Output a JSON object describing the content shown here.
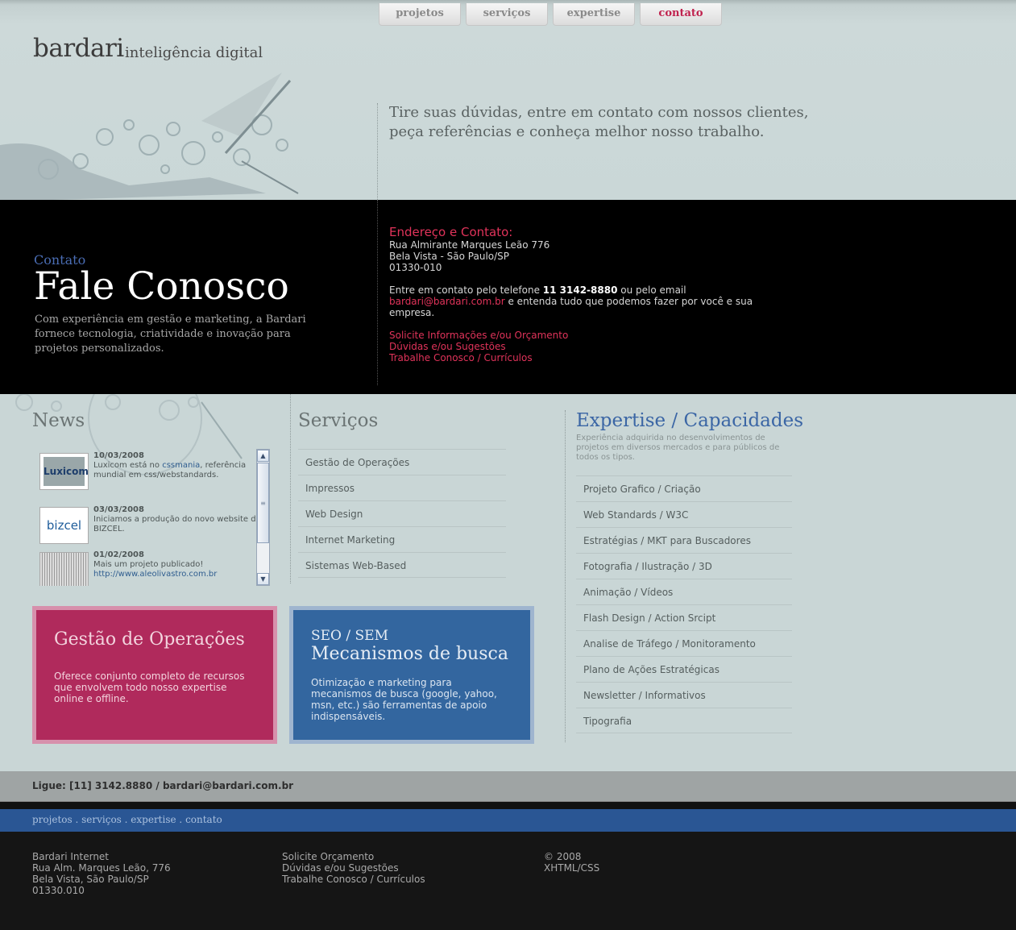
{
  "nav": {
    "items": [
      "projetos",
      "serviços",
      "expertise",
      "contato"
    ],
    "active": "contato"
  },
  "header": {
    "logo": "bardari",
    "tagline": "inteligência digital",
    "intro_line1": "Tire suas dúvidas, entre em contato com nossos clientes,",
    "intro_line2": "peça referências e conheça melhor nosso trabalho."
  },
  "hero": {
    "kicker": "Contato",
    "title": "Fale Conosco",
    "text": "Com experiência em gestão e marketing, a Bardari fornece tecnologia, criatividade e inovação para projetos personalizados."
  },
  "contact": {
    "heading": "Endereço e Contato:",
    "address1": "Rua Almirante Marques Leão 776",
    "address2": "Bela Vista - São Paulo/SP",
    "zip": "01330-010",
    "text_pre": "Entre em contato pelo telefone ",
    "phone": "11 3142-8880",
    "text_mid": " ou pelo email",
    "email": "bardari@bardari.com.br",
    "text_post": " e entenda tudo que podemos fazer por você e sua empresa.",
    "links": [
      "Solicite Informações e/ou Orçamento",
      "Dúvidas e/ou Sugestões",
      "Trabalhe Conosco / Currículos"
    ]
  },
  "news": {
    "title": "News",
    "items": [
      {
        "date": "10/03/2008",
        "text_pre": "Luxicom está no ",
        "link": "cssmania",
        "text_post": ", referência mundial em css/webstandards.",
        "thumb": "Luxicom"
      },
      {
        "date": "03/03/2008",
        "text_pre": "Iniciamos a produção do novo website da BIZCEL.",
        "link": "",
        "text_post": "",
        "thumb": "bizcel"
      },
      {
        "date": "01/02/2008",
        "text_pre": "Mais um projeto publicado!",
        "link": "http://www.aleolivastro.com.br",
        "text_post": "",
        "thumb": ""
      }
    ]
  },
  "services": {
    "title": "Serviços",
    "items": [
      "Gestão de Operações",
      "Impressos",
      "Web Design",
      "Internet Marketing",
      "Sistemas Web-Based"
    ]
  },
  "expertise": {
    "title": "Expertise / Capacidades",
    "desc": "Experiência adquirida no desenvolvimentos de projetos em diversos mercados e para públicos de todos os tipos.",
    "items": [
      "Projeto Grafico / Criação",
      "Web Standards / W3C",
      "Estratégias / MKT para Buscadores",
      "Fotografia / Ilustração / 3D",
      "Animação / Vídeos",
      "Flash Design / Action Srcipt",
      "Analise de Tráfego / Monitoramento",
      "Plano de Ações Estratégicas",
      "Newsletter / Informativos",
      "Tipografia"
    ]
  },
  "promo_red": {
    "title": "Gestão de Operações",
    "text": "Oferece conjunto completo de recursos que envolvem todo nosso expertise online e offline."
  },
  "promo_blue": {
    "kicker": "SEO / SEM",
    "title": "Mecanismos de busca",
    "text": "Otimização e marketing para mecanismos de busca (google, yahoo, msn, etc.) são ferramentas de apoio indispensáveis."
  },
  "callbar": "Ligue: [11] 3142.8880 / bardari@bardari.com.br",
  "footer_nav": [
    "projetos",
    "serviços",
    "expertise",
    "contato"
  ],
  "footer": {
    "col1": [
      "Bardari Internet",
      "Rua Alm. Marques Leão, 776",
      "Bela Vista, São Paulo/SP",
      "01330.010"
    ],
    "col2": [
      "Solicite Orçamento",
      "Dúvidas e/ou Sugestões",
      "Trabalhe Conosco / Currículos"
    ],
    "col3": [
      "© 2008",
      "XHTML/CSS"
    ]
  },
  "colors": {
    "accent_red": "#e0335a",
    "accent_blue": "#3b66a5",
    "promo_red": "#b02a5c",
    "promo_blue": "#33669f"
  }
}
